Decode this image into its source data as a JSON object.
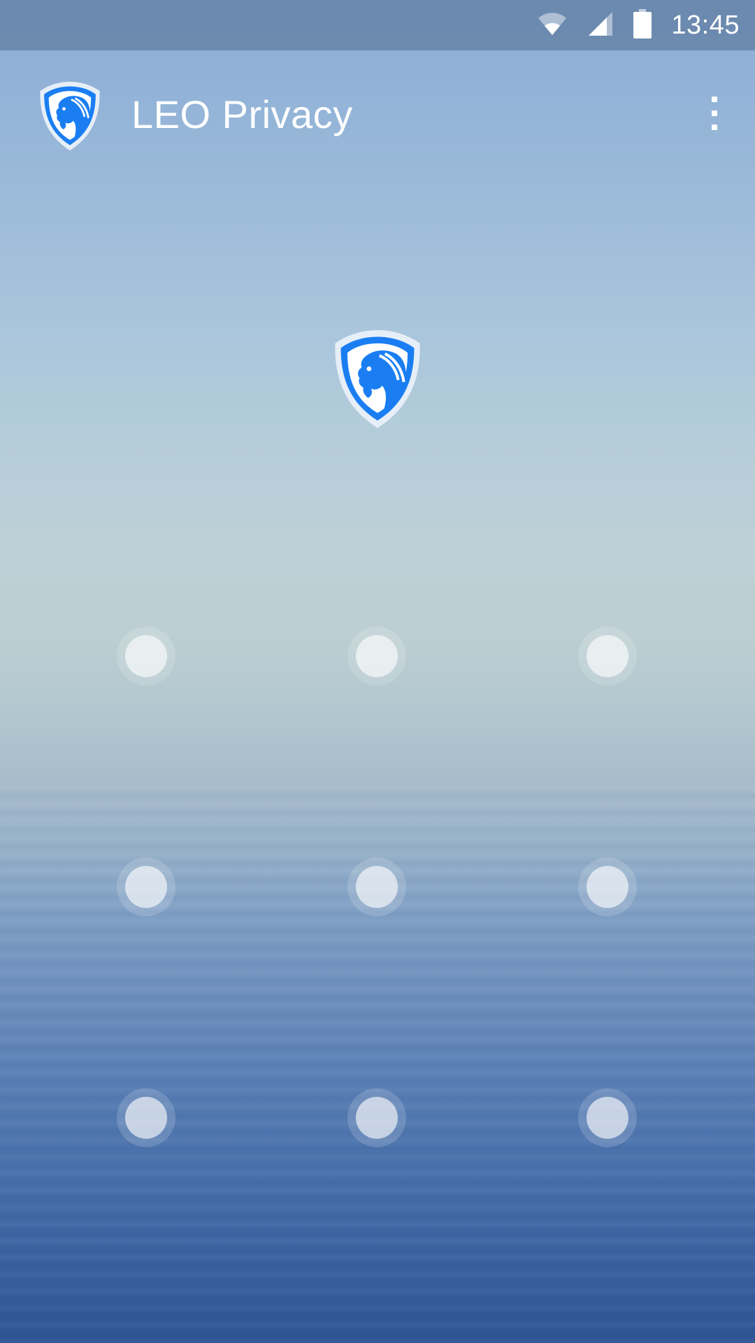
{
  "status_bar": {
    "time": "13:45",
    "icons": [
      "wifi-icon",
      "signal-icon",
      "battery-icon"
    ]
  },
  "app_bar": {
    "title": "LEO Privacy",
    "logo_icon": "leo-shield-icon",
    "menu_icon": "overflow-menu-icon"
  },
  "lock_screen": {
    "center_icon": "leo-shield-icon",
    "pattern_dots": [
      {
        "row": 1,
        "col": 1
      },
      {
        "row": 1,
        "col": 2
      },
      {
        "row": 1,
        "col": 3
      },
      {
        "row": 2,
        "col": 1
      },
      {
        "row": 2,
        "col": 2
      },
      {
        "row": 2,
        "col": 3
      },
      {
        "row": 3,
        "col": 1
      },
      {
        "row": 3,
        "col": 2
      },
      {
        "row": 3,
        "col": 3
      }
    ]
  },
  "colors": {
    "brand_blue": "#1a7ef2",
    "brand_blue_dark": "#0d5fd4",
    "status_bar_bg": "#5f7da0",
    "text_white": "#ffffff"
  }
}
